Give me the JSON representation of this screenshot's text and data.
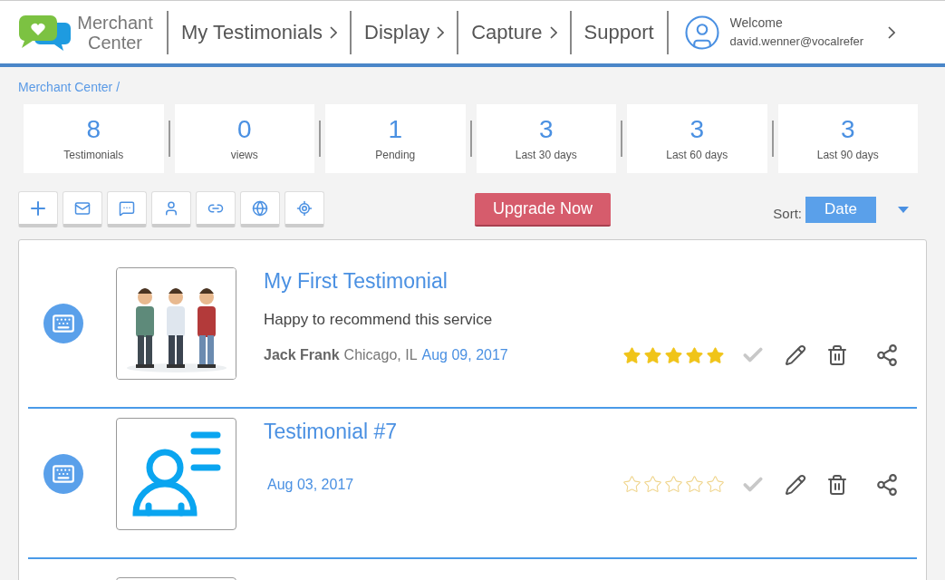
{
  "header": {
    "logo_text": "Merchant Center",
    "nav": [
      {
        "label": "My Testimonials",
        "chevron": true
      },
      {
        "label": "Display",
        "chevron": true
      },
      {
        "label": "Capture",
        "chevron": true
      },
      {
        "label": "Support",
        "chevron": false
      }
    ],
    "user": {
      "greeting": "Welcome",
      "email": "david.wenner@vocalrefer"
    }
  },
  "breadcrumb": [
    {
      "label": "Merchant Center",
      "separator": "/"
    }
  ],
  "stats": [
    {
      "value": "8",
      "label": "Testimonials"
    },
    {
      "value": "0",
      "label": "views"
    },
    {
      "value": "1",
      "label": "Pending"
    },
    {
      "value": "3",
      "label": "Last 30 days"
    },
    {
      "value": "3",
      "label": "Last 60 days"
    },
    {
      "value": "3",
      "label": "Last 90 days"
    }
  ],
  "toolbar": {
    "tools": [
      {
        "kind": "plus"
      },
      {
        "kind": "mail"
      },
      {
        "kind": "chat"
      },
      {
        "kind": "user"
      },
      {
        "kind": "link"
      },
      {
        "kind": "globe"
      },
      {
        "kind": "target"
      }
    ],
    "upgrade": "Upgrade Now",
    "sort_label": "Sort:",
    "sort_value": "Date"
  },
  "testimonials": [
    {
      "kind": "picture",
      "title": "My First Testimonial",
      "text": "Happy to recommend this service",
      "author": "Jack Frank",
      "location": "Chicago, IL",
      "date": "Aug 09, 2017",
      "stars": 5
    },
    {
      "kind": "avatar",
      "title": "Testimonial #7",
      "date": "Aug 03, 2017",
      "stars": 0
    }
  ]
}
